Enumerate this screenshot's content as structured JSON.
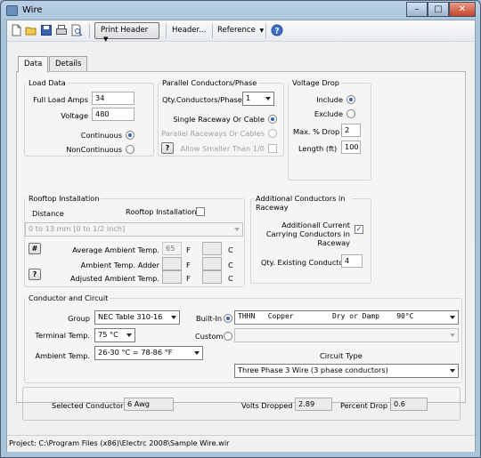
{
  "window": {
    "title": "Wire"
  },
  "toolbar": {
    "print_header": "Print Header",
    "header_menu": "Header...",
    "reference_menu": "Reference",
    "help_icon": "question-circle-icon"
  },
  "tabs": [
    "Data",
    "Details"
  ],
  "load_data": {
    "title": "Load Data",
    "full_load_amps_label": "Full Load Amps",
    "full_load_amps": "34",
    "voltage_label": "Voltage",
    "voltage": "480",
    "continuous_label": "Continuous",
    "noncontinuous_label": "NonContinuous"
  },
  "parallel": {
    "title": "Parallel Conductors/Phase",
    "qty_label": "Qty.Conductors/Phase",
    "qty_value": "1",
    "single_raceway": "Single Raceway Or Cable",
    "parallel_raceways": "Parallel Raceways Or Cables",
    "allow_smaller": "Allow Smaller Than 1/0",
    "help_button": "?"
  },
  "voltage_drop": {
    "title": "Voltage Drop",
    "include_label": "Include",
    "exclude_label": "Exclude",
    "max_drop_label": "Max. % Drop",
    "max_drop": "2",
    "length_label": "Length (ft)",
    "length": "100"
  },
  "rooftop": {
    "title": "Rooftop Installation",
    "distance_label": "Distance",
    "install_label": "Rooftop Installation",
    "distance_value": "0 to 13 mm [0 to 1/2 inch]",
    "avg_ambient_label": "Average Ambient Temp.",
    "avg_ambient_value": "65",
    "temp_adder_label": "Ambient Temp. Adder",
    "adjusted_label": "Adjusted Ambient Temp.",
    "unit_f": "F",
    "unit_c": "C",
    "hash_button": "#",
    "help_button": "?"
  },
  "additional": {
    "title": "Additional Conductors in Raceway",
    "current_carrying_label": "Additionall Current Carrying Conductors in Raceway",
    "qty_existing_label": "Qty. Existing Conductors",
    "qty_existing": "4"
  },
  "conductor": {
    "title": "Conductor and Circuit",
    "group_label": "Group",
    "group_value": "NEC Table 310-16",
    "terminal_label": "Terminal Temp.",
    "terminal_value": "75 °C",
    "ambient_label": "Ambient Temp.",
    "ambient_value": "26-30 °C = 78-86 °F",
    "builtin_label": "Built-In",
    "builtin_value": "THHN   Copper         Dry or Damp    90°C",
    "custom_label": "Custom",
    "circuit_type_label": "Circuit Type",
    "circuit_type_value": "Three Phase 3 Wire (3 phase conductors)"
  },
  "results": {
    "selected_conductor_label": "Selected Conductor",
    "selected_conductor": "6 Awg",
    "volts_dropped_label": "Volts Dropped",
    "volts_dropped": "2.89",
    "percent_drop_label": "Percent Drop",
    "percent_drop": "0.6"
  },
  "status": {
    "project": "Project: C:\\Program Files (x86)\\Electrc 2008\\Sample Wire.wir"
  }
}
